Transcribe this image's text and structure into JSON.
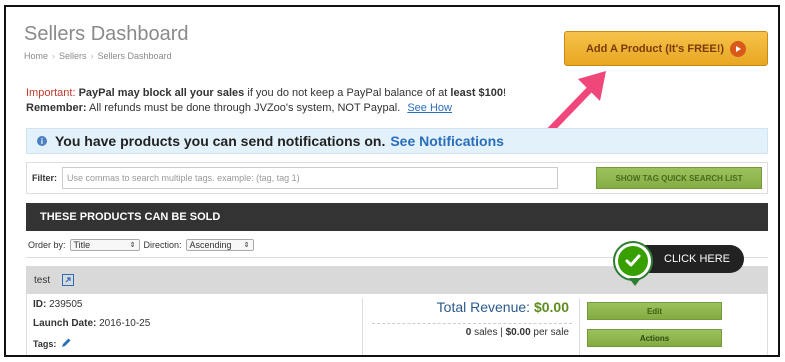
{
  "header": {
    "title": "Sellers Dashboard",
    "breadcrumb": [
      "Home",
      "Sellers",
      "Sellers Dashboard"
    ],
    "add_product_label": "Add A Product (It's FREE!)"
  },
  "notices": {
    "important_label": "Important:",
    "paypal_warning_strong": "PayPal may block all your sales",
    "paypal_warning_middle": " if you do not keep a PayPal balance of at ",
    "paypal_warning_amount": "least $100",
    "paypal_warning_end": "!",
    "remember_label": "Remember:",
    "remember_text": " All refunds must be done through JVZoo's system, NOT Paypal.",
    "see_how_link": "See How"
  },
  "info_bar": {
    "text": "You have products you can send notifications on.",
    "link": "See Notifications"
  },
  "filter": {
    "label": "Filter:",
    "placeholder": "Use commas to search multiple tags. example: (tag, tag 1)",
    "tag_button": "SHOW TAG QUICK SEARCH LIST"
  },
  "products_section": {
    "title": "THESE PRODUCTS CAN BE SOLD",
    "order_by_label": "Order by:",
    "order_by_value": "Title",
    "direction_label": "Direction:",
    "direction_value": "Ascending"
  },
  "product": {
    "name": "test",
    "id_label": "ID:",
    "id_value": " 239505",
    "launch_label": "Launch Date:",
    "launch_value": " 2016-10-25",
    "tags_label": "Tags:",
    "revenue_label": "Total Revenue: ",
    "revenue_value": "$0.00",
    "sales_count": "0",
    "sales_text": " sales | ",
    "per_sale_value": "$0.00",
    "per_sale_text": " per sale",
    "edit_label": "Edit",
    "actions_label": "Actions"
  },
  "callout": {
    "text": "CLICK HERE"
  },
  "colors": {
    "accent_orange": "#e8a722",
    "arrow_pink": "#f0477a",
    "green_button": "#86ae45",
    "check_green": "#37a000"
  }
}
